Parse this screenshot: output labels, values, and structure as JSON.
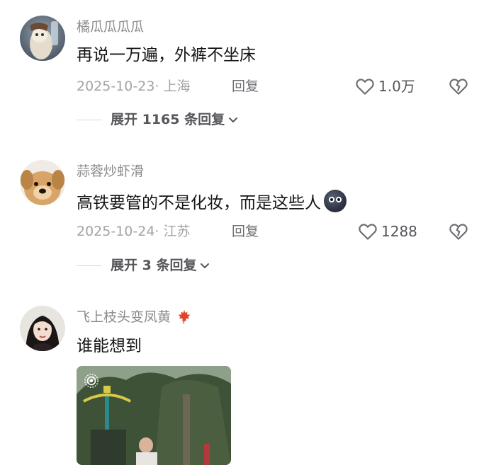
{
  "comments": [
    {
      "username": "橘瓜瓜瓜瓜",
      "text": "再说一万遍，外裤不坐床",
      "date": "2025-10-23· 上海",
      "reply_label": "回复",
      "likes": "1.0万",
      "expand_label": "展开 1165 条回复"
    },
    {
      "username": "蒜蓉炒虾滑",
      "text": "高铁要管的不是化妆，而是这些人",
      "date": "2025-10-24· 江苏",
      "reply_label": "回复",
      "likes": "1288",
      "expand_label": "展开 3 条回复"
    },
    {
      "username": "飞上枝头变凤黄",
      "text": "谁能想到"
    }
  ],
  "icons": {
    "like": "heart-outline-icon",
    "dislike": "broken-heart-icon",
    "expand": "chevron-down-icon",
    "live_photo": "live-photo-icon",
    "username_badge": "maple-leaf-icon"
  },
  "colors": {
    "text": "#161616",
    "username": "#8a8a8e",
    "meta": "#a3a3a8",
    "badge": "#e0452b"
  }
}
